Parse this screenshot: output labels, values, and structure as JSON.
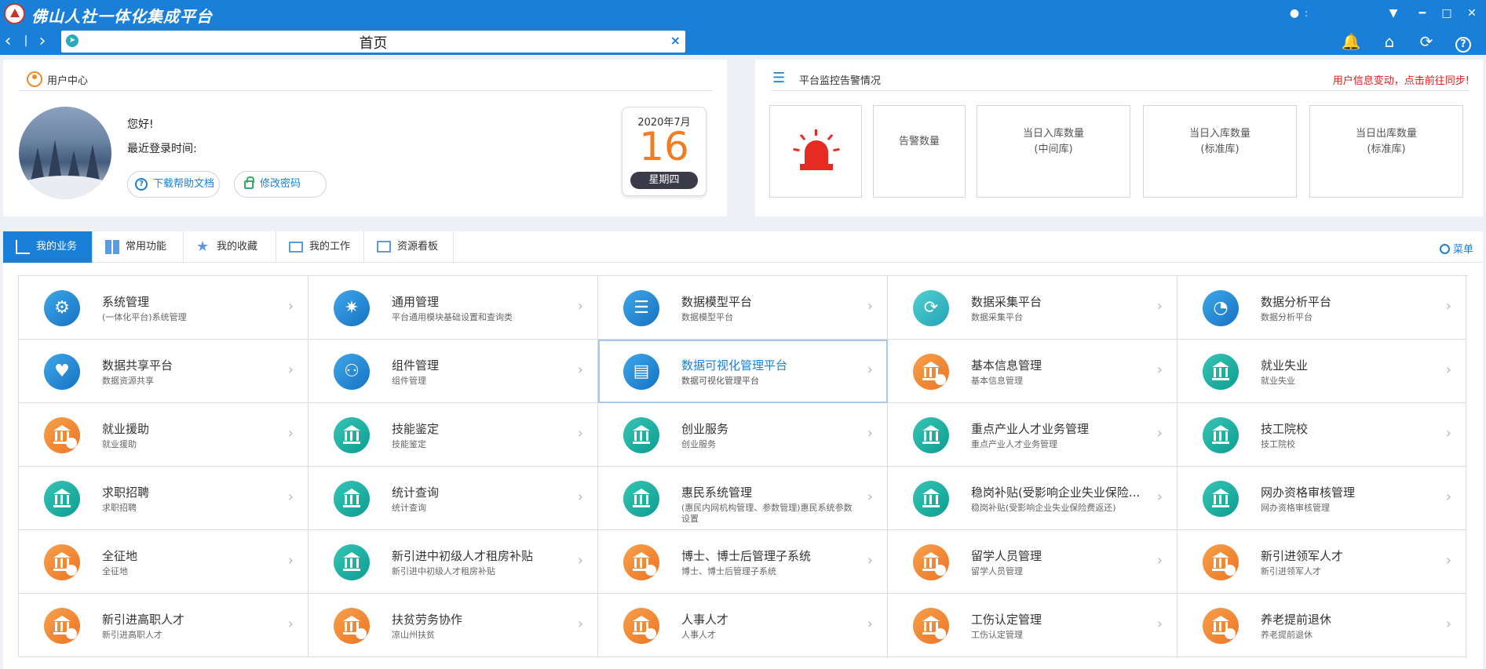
{
  "app": {
    "title": "佛山人社一体化集成平台",
    "user_label": ":"
  },
  "window": {
    "menu_icon": "dropdown-icon",
    "min_icon": "minimize-icon",
    "max_icon": "maximize-icon",
    "close_icon": "close-icon"
  },
  "tabbar": {
    "active_tab": "首页",
    "close_glyph": "×",
    "back_glyph": "‹",
    "fwd_glyph": "›",
    "sep_glyph": "|",
    "help_glyph": "?"
  },
  "user_center": {
    "title": "用户中心",
    "greeting": "您好! ",
    "last_login_label": "最近登录时间:",
    "download_help_label": "下载帮助文档",
    "change_password_label": "修改密码"
  },
  "calendar": {
    "month": "2020年7月",
    "day": "16",
    "weekday": "星期四"
  },
  "monitor": {
    "title": "平台监控告警情况",
    "alert_link": "用户信息变动，点击前往同步!",
    "boxes": [
      {
        "label": "告警数量",
        "sub": ""
      },
      {
        "label": "当日入库数量",
        "sub": "(中间库)"
      },
      {
        "label": "当日入库数量",
        "sub": "(标准库)"
      },
      {
        "label": "当日出库数量",
        "sub": "(标准库)"
      }
    ]
  },
  "menu_tabs": [
    "我的业务",
    "常用功能",
    "我的收藏",
    "我的工作",
    "资源看板"
  ],
  "menu_search_label": "菜单",
  "modules": [
    {
      "title": "系统管理",
      "sub": "(一体化平台)系统管理",
      "icon": "gear-icon",
      "color": "blue"
    },
    {
      "title": "通用管理",
      "sub": "平台通用模块基础设置和查询类",
      "icon": "network-icon",
      "color": "blue"
    },
    {
      "title": "数据模型平台",
      "sub": "数据模型平台",
      "icon": "database-icon",
      "color": "blue"
    },
    {
      "title": "数据采集平台",
      "sub": "数据采集平台",
      "icon": "database-sync-icon",
      "color": "cyan"
    },
    {
      "title": "数据分析平台",
      "sub": "数据分析平台",
      "icon": "pie-chart-icon",
      "color": "blue"
    },
    {
      "title": "数据共享平台",
      "sub": "数据资源共享",
      "icon": "hand-heart-icon",
      "color": "blue"
    },
    {
      "title": "组件管理",
      "sub": "组件管理",
      "icon": "people-chart-icon",
      "color": "blue"
    },
    {
      "title": "数据可视化管理平台",
      "sub": "数据可视化管理平台",
      "icon": "monitor-icon",
      "color": "blue"
    },
    {
      "title": "基本信息管理",
      "sub": "基本信息管理",
      "icon": "building-icon",
      "color": "orange"
    },
    {
      "title": "就业失业",
      "sub": "就业失业",
      "icon": "building-icon",
      "color": "teal"
    },
    {
      "title": "就业援助",
      "sub": "就业援助",
      "icon": "building-icon",
      "color": "orange"
    },
    {
      "title": "技能鉴定",
      "sub": "技能鉴定",
      "icon": "building-icon",
      "color": "teal"
    },
    {
      "title": "创业服务",
      "sub": "创业服务",
      "icon": "building-icon",
      "color": "teal"
    },
    {
      "title": "重点产业人才业务管理",
      "sub": "重点产业人才业务管理",
      "icon": "building-icon",
      "color": "teal"
    },
    {
      "title": "技工院校",
      "sub": "技工院校",
      "icon": "building-icon",
      "color": "teal"
    },
    {
      "title": "求职招聘",
      "sub": "求职招聘",
      "icon": "building-icon",
      "color": "teal"
    },
    {
      "title": "统计查询",
      "sub": "统计查询",
      "icon": "building-icon",
      "color": "teal"
    },
    {
      "title": "惠民系统管理",
      "sub": "(惠民内网机构管理、参数管理)惠民系统参数设置",
      "icon": "building-icon",
      "color": "teal"
    },
    {
      "title": "稳岗补贴(受影响企业失业保险...",
      "sub": "稳岗补贴(受影响企业失业保险费返还)",
      "icon": "building-icon",
      "color": "teal"
    },
    {
      "title": "网办资格审核管理",
      "sub": "网办资格审核管理",
      "icon": "building-icon",
      "color": "teal"
    },
    {
      "title": "全征地",
      "sub": "全征地",
      "icon": "building-icon",
      "color": "orange"
    },
    {
      "title": "新引进中初级人才租房补贴",
      "sub": "新引进中初级人才租房补贴",
      "icon": "building-icon",
      "color": "teal"
    },
    {
      "title": "博士、博士后管理子系统",
      "sub": "博士、博士后管理子系统",
      "icon": "building-icon",
      "color": "orange"
    },
    {
      "title": "留学人员管理",
      "sub": "留学人员管理",
      "icon": "building-icon",
      "color": "orange"
    },
    {
      "title": "新引进领军人才",
      "sub": "新引进领军人才",
      "icon": "building-icon",
      "color": "orange"
    },
    {
      "title": "新引进高职人才",
      "sub": "新引进高职人才",
      "icon": "building-icon",
      "color": "orange"
    },
    {
      "title": "扶贫劳务协作",
      "sub": "凉山州扶贫",
      "icon": "building-icon",
      "color": "orange"
    },
    {
      "title": "人事人才",
      "sub": "人事人才",
      "icon": "building-icon",
      "color": "orange"
    },
    {
      "title": "工伤认定管理",
      "sub": "工伤认定管理",
      "icon": "building-icon",
      "color": "orange"
    },
    {
      "title": "养老提前退休",
      "sub": "养老提前退休",
      "icon": "building-icon",
      "color": "orange"
    }
  ],
  "active_module": "数据可视化管理平台"
}
